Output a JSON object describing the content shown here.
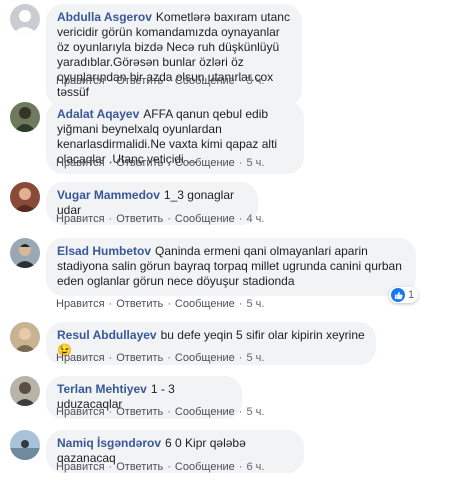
{
  "actions": {
    "like": "Нравится",
    "reply": "Ответить",
    "message": "Сообщение",
    "sep": "·"
  },
  "comments": [
    {
      "name": "Abdulla Asgerov",
      "text": "Kometlərə baxıram utanc vericidir görün komandamızda oynayanlar öz oyunlarıyla bizdə Necə ruh düşkünlüyü yaradıblar.Görəsən bunlar özləri öz oyunlarından bir azda olsun utanırlar.cox təssüf",
      "time": "3 ч."
    },
    {
      "name": "Adalat Aqayev",
      "text": "AFFA qanun qebul edib yiğmani beynelxalq oyunlardan kenarlasdirmalidi.Ne vaxta kimi qapaz alti olacaqlar .Utanç vetiçidi ...",
      "time": "5 ч."
    },
    {
      "name": "Vugar Mammedov",
      "text": "1_3 gonaglar udar",
      "time": "4 ч."
    },
    {
      "name": "Elsad Humbetov",
      "text": "Qaninda ermeni qani olmayanlari aparin stadiyona salin görun bayraq torpaq millet ugrunda canini qurban eden oglanlar görun nece döyuşur stadionda",
      "time": "5 ч.",
      "reaction_count": "1"
    },
    {
      "name": "Resul Abdullayev",
      "text": "bu defe yeqin 5 sifir olar kipirin xeyrine😉",
      "time": "5 ч."
    },
    {
      "name": "Terlan Mehtiyev",
      "text": "1 - 3 uduzacaqlar",
      "time": "5 ч."
    },
    {
      "name": "Namiq İsgəndərov",
      "text": "6 0 Kipr qələbə qazanacaq",
      "time": "6 ч."
    }
  ]
}
